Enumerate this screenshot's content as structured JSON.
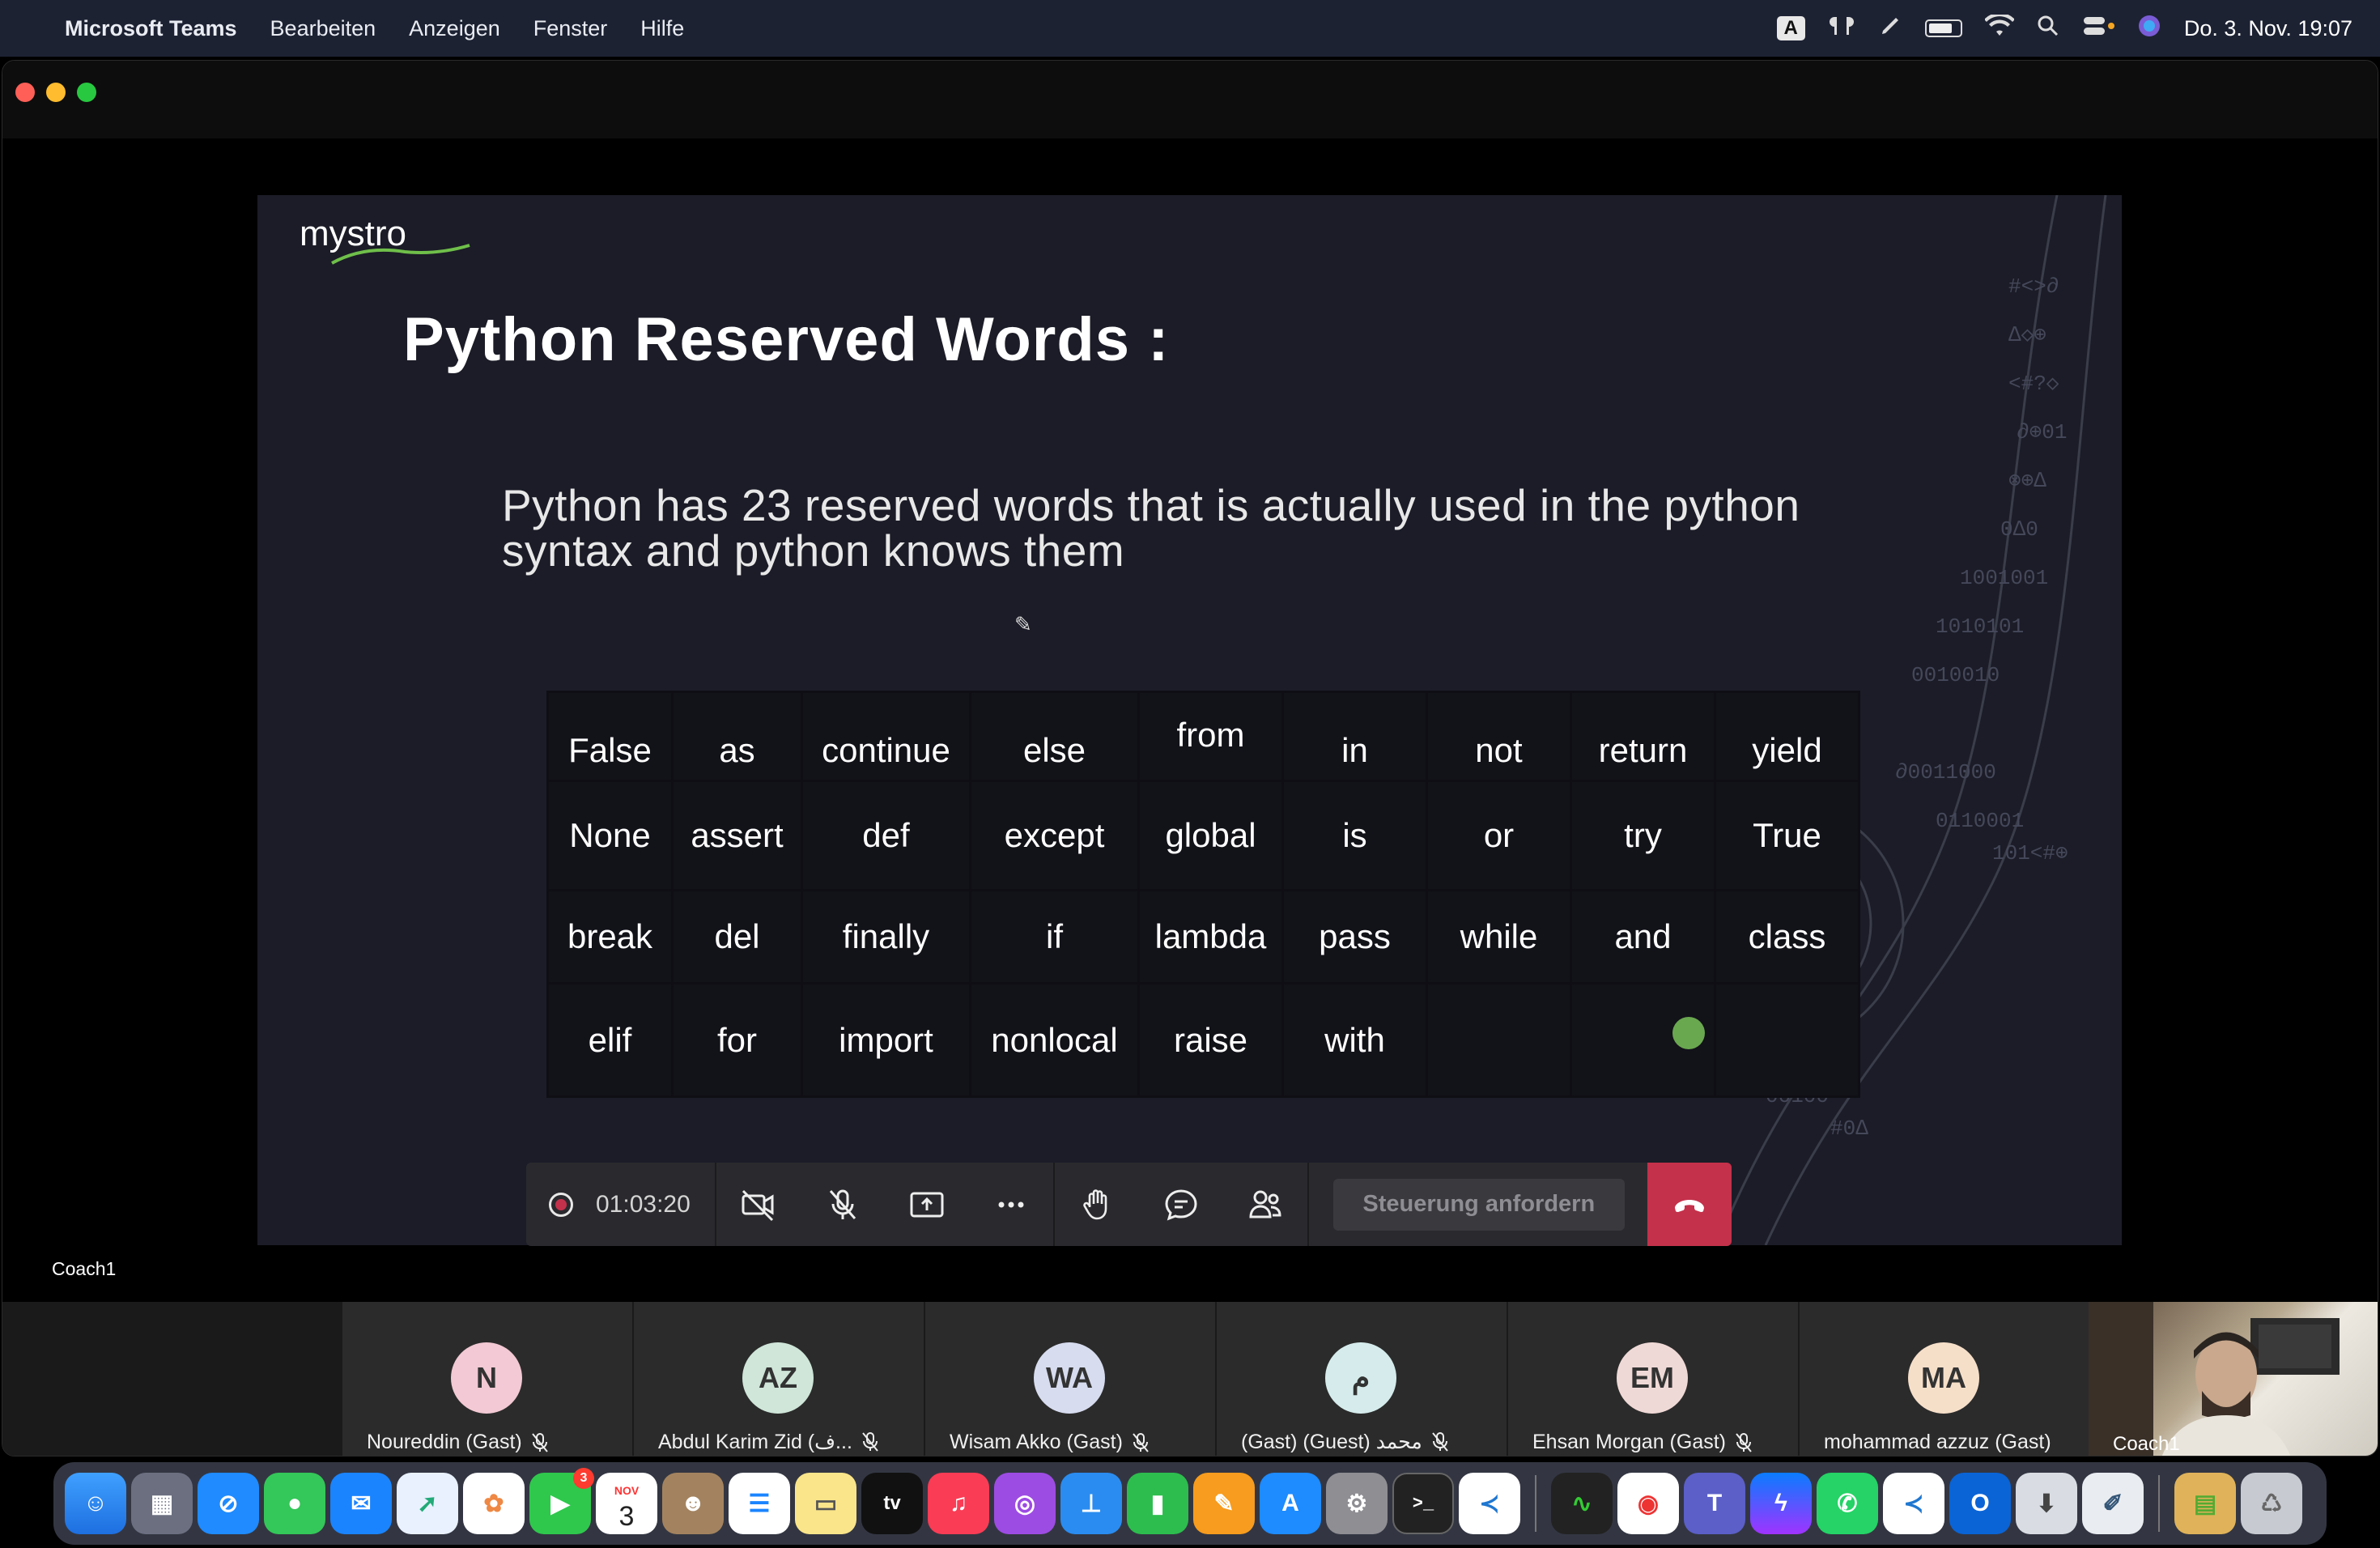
{
  "menubar": {
    "app_name": "Microsoft Teams",
    "menus": [
      "Bearbeiten",
      "Anzeigen",
      "Fenster",
      "Hilfe"
    ],
    "input_source": "A",
    "datetime": "Do. 3. Nov.  19:07"
  },
  "slide": {
    "logo_text": "mystro",
    "title": "Python Reserved Words :",
    "text_line1": "Python has 23 reserved words that is actually used in the python",
    "text_line2": "syntax and python knows them",
    "table": [
      [
        "False",
        "as",
        "continue",
        "else",
        "from",
        "in",
        "not",
        "return",
        "yield"
      ],
      [
        "None",
        "assert",
        "def",
        "except",
        "global",
        "is",
        "or",
        "try",
        "True"
      ],
      [
        "break",
        "del",
        "finally",
        "if",
        "lambda",
        "pass",
        "while",
        "and",
        "class"
      ],
      [
        "elif",
        "for",
        "import",
        "nonlocal",
        "raise",
        "with",
        "",
        "",
        ""
      ]
    ]
  },
  "controls": {
    "timer": "01:03:20",
    "request_control": "Steuerung anfordern"
  },
  "presenter": "Coach1",
  "participants": [
    {
      "initials": "N",
      "name": "Noureddin (Gast)",
      "color": "#f2c9d4"
    },
    {
      "initials": "AZ",
      "name": "Abdul Karim Zid (ف...",
      "color": "#cfe6d9"
    },
    {
      "initials": "WA",
      "name": "Wisam Akko (Gast)",
      "color": "#d7dcef"
    },
    {
      "initials": "م",
      "name": "(Gast) (Guest) محمد",
      "color": "#d6ecec"
    },
    {
      "initials": "EM",
      "name": "Ehsan Morgan (Gast)",
      "color": "#efd9d6"
    },
    {
      "initials": "MA",
      "name": "mohammad azzuz (Gast)",
      "color": "#f6dfc9"
    }
  ],
  "video_tile": {
    "name": "Coach1"
  },
  "dock": {
    "calendar_month": "NOV",
    "calendar_day": "3",
    "facetime_badge": "3",
    "tv_label": "tv"
  }
}
